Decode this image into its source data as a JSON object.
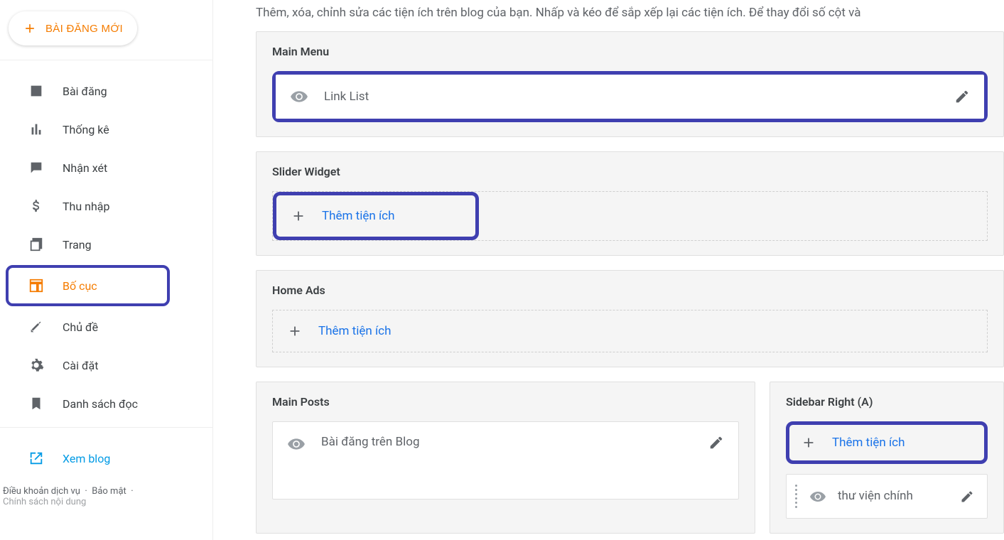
{
  "sidebar": {
    "new_post": "BÀI ĐĂNG MỚI",
    "items": [
      {
        "label": "Bài đăng"
      },
      {
        "label": "Thống kê"
      },
      {
        "label": "Nhận xét"
      },
      {
        "label": "Thu nhập"
      },
      {
        "label": "Trang"
      },
      {
        "label": "Bố cục"
      },
      {
        "label": "Chủ đề"
      },
      {
        "label": "Cài đặt"
      },
      {
        "label": "Danh sách đọc"
      },
      {
        "label": "Xem blog"
      }
    ],
    "footer": {
      "terms": "Điều khoản dịch vụ",
      "privacy": "Bảo mật",
      "content_policy": "Chính sách nội dung"
    }
  },
  "main": {
    "description": "Thêm, xóa, chỉnh sửa các tiện ích trên blog của bạn. Nhấp và kéo để sắp xếp lại các tiện ích. Để thay đổi số cột và",
    "sections": {
      "main_menu": {
        "title": "Main Menu",
        "widget": "Link List"
      },
      "slider": {
        "title": "Slider Widget",
        "add": "Thêm tiện ích"
      },
      "home_ads": {
        "title": "Home Ads",
        "add": "Thêm tiện ích"
      },
      "main_posts": {
        "title": "Main Posts",
        "widget": "Bài đăng trên Blog"
      },
      "sidebar_right": {
        "title": "Sidebar Right (A)",
        "add": "Thêm tiện ích",
        "widget": "thư viện chính"
      }
    }
  }
}
